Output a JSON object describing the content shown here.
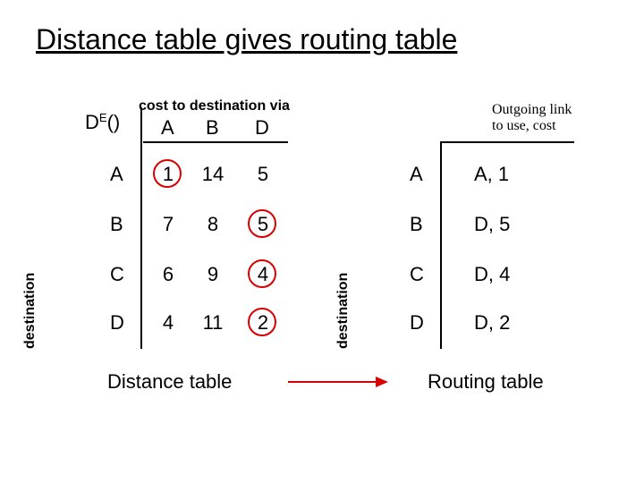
{
  "title": "Distance table gives routing table",
  "left": {
    "subtitle": "cost to destination via",
    "de_label_base": "D",
    "de_label_sup": "E",
    "de_label_paren": "()",
    "col_headers": [
      "A",
      "B",
      "D"
    ],
    "row_headers": [
      "A",
      "B",
      "C",
      "D"
    ],
    "dest_label": "destination",
    "cells": {
      "A": {
        "A": "1",
        "B": "14",
        "D": "5"
      },
      "B": {
        "A": "7",
        "B": "8",
        "D": "5"
      },
      "C": {
        "A": "6",
        "B": "9",
        "D": "4"
      },
      "D": {
        "A": "4",
        "B": "11",
        "D": "2"
      }
    },
    "caption": "Distance table"
  },
  "right": {
    "subtitle_line1": "Outgoing link",
    "subtitle_line2": "to use, cost",
    "dest_label": "destination",
    "rows": [
      {
        "label": "A",
        "value": "A, 1"
      },
      {
        "label": "B",
        "value": "D, 5"
      },
      {
        "label": "C",
        "value": "D, 4"
      },
      {
        "label": "D",
        "value": "D, 2"
      }
    ],
    "caption": "Routing table"
  },
  "chart_data": {
    "type": "table",
    "distance_table": {
      "node": "E",
      "via": [
        "A",
        "B",
        "D"
      ],
      "destinations": [
        "A",
        "B",
        "C",
        "D"
      ],
      "cost": [
        [
          1,
          14,
          5
        ],
        [
          7,
          8,
          5
        ],
        [
          6,
          9,
          4
        ],
        [
          4,
          11,
          2
        ]
      ],
      "min_index_per_row": [
        0,
        2,
        2,
        2
      ]
    },
    "routing_table": {
      "destinations": [
        "A",
        "B",
        "C",
        "D"
      ],
      "outgoing_link": [
        "A",
        "D",
        "D",
        "D"
      ],
      "cost": [
        1,
        5,
        4,
        2
      ]
    }
  }
}
